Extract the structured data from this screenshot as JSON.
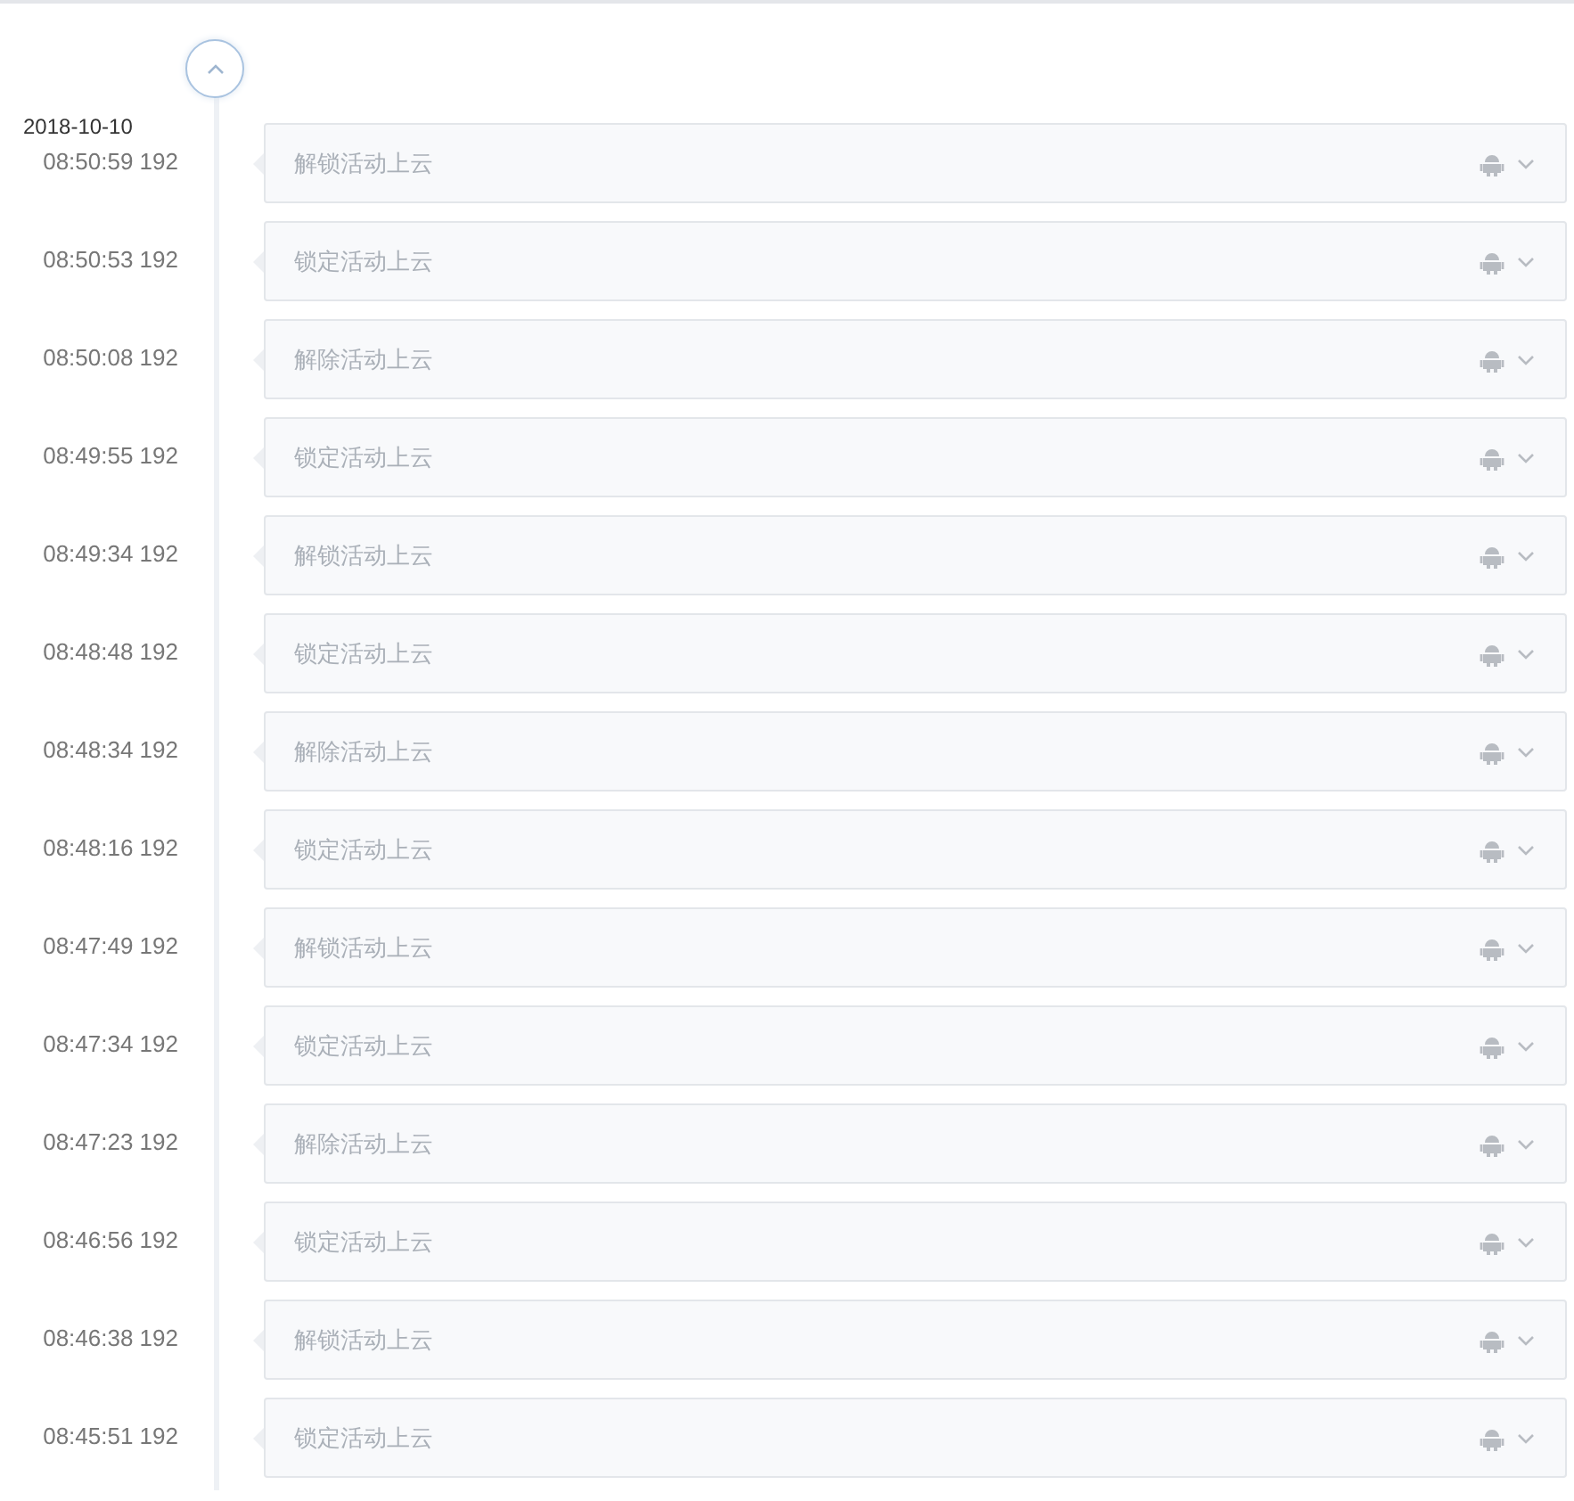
{
  "date": "2018-10-10",
  "events": [
    {
      "time": "08:50:59 192",
      "text": "解锁活动上云",
      "expanded": false
    },
    {
      "time": "08:50:53 192",
      "text": "锁定活动上云",
      "expanded": false
    },
    {
      "time": "08:50:08 192",
      "text": "解除活动上云",
      "expanded": false
    },
    {
      "time": "08:49:55 192",
      "text": "锁定活动上云",
      "expanded": false
    },
    {
      "time": "08:49:34 192",
      "text": "解锁活动上云",
      "expanded": false
    },
    {
      "time": "08:48:48 192",
      "text": "锁定活动上云",
      "expanded": false
    },
    {
      "time": "08:48:34 192",
      "text": "解除活动上云",
      "expanded": false
    },
    {
      "time": "08:48:16 192",
      "text": "锁定活动上云",
      "expanded": false
    },
    {
      "time": "08:47:49 192",
      "text": "解锁活动上云",
      "expanded": false
    },
    {
      "time": "08:47:34 192",
      "text": "锁定活动上云",
      "expanded": false
    },
    {
      "time": "08:47:23 192",
      "text": "解除活动上云",
      "expanded": false
    },
    {
      "time": "08:46:56 192",
      "text": "锁定活动上云",
      "expanded": false
    },
    {
      "time": "08:46:38 192",
      "text": "解锁活动上云",
      "expanded": false
    },
    {
      "time": "08:45:51 192",
      "text": "锁定活动上云",
      "expanded": false
    }
  ]
}
